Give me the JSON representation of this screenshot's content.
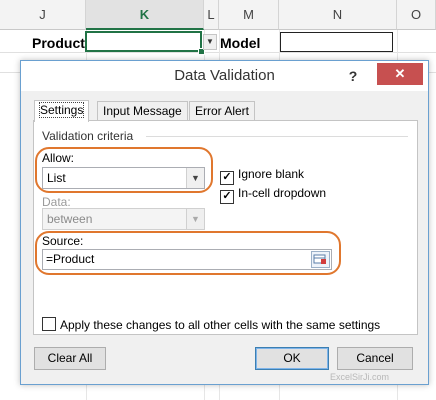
{
  "sheet": {
    "columns": [
      "J",
      "K",
      "L",
      "M",
      "N",
      "O"
    ],
    "selected_column": "K",
    "cells": {
      "product_label": "Product",
      "model_label": "Model"
    }
  },
  "dialog": {
    "title": "Data Validation",
    "help_label": "?",
    "close_label": "✕",
    "tabs": [
      "Settings",
      "Input Message",
      "Error Alert"
    ],
    "active_tab": "Settings",
    "group_title": "Validation criteria",
    "allow": {
      "label": "Allow:",
      "value": "List"
    },
    "data": {
      "label": "Data:",
      "value": "between",
      "disabled": true
    },
    "ignore_blank": {
      "label": "Ignore blank",
      "checked": true
    },
    "in_cell_dropdown": {
      "label": "In-cell dropdown",
      "checked": true
    },
    "source": {
      "label": "Source:",
      "value": "=Product"
    },
    "apply_all": {
      "label": "Apply these changes to all other cells with the same settings",
      "checked": false
    },
    "buttons": {
      "clear_all": "Clear All",
      "ok": "OK",
      "cancel": "Cancel"
    }
  },
  "colors": {
    "highlight_ring": "#e0772e",
    "excel_green": "#217346",
    "close_red": "#c75050"
  },
  "watermark": "ExcelSirJi.com"
}
